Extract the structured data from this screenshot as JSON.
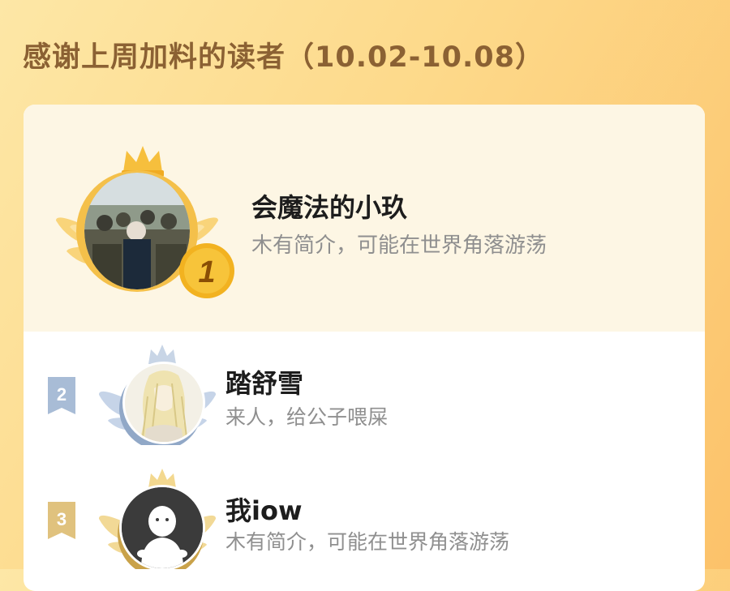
{
  "heading": "感谢上周加料的读者（10.02-10.08）",
  "colors": {
    "accent_gold": "#f3b52e",
    "heading_brown": "#8b6133",
    "silver": "#a8bcd6",
    "bronze": "#e0c27e"
  },
  "readers": [
    {
      "rank": "1",
      "name": "会魔法的小玖",
      "bio": "木有简介，可能在世界角落游荡"
    },
    {
      "rank": "2",
      "name": "踏舒雪",
      "bio": "来人，给公子喂屎"
    },
    {
      "rank": "3",
      "name": "我iow",
      "bio": "木有简介，可能在世界角落游荡"
    }
  ]
}
